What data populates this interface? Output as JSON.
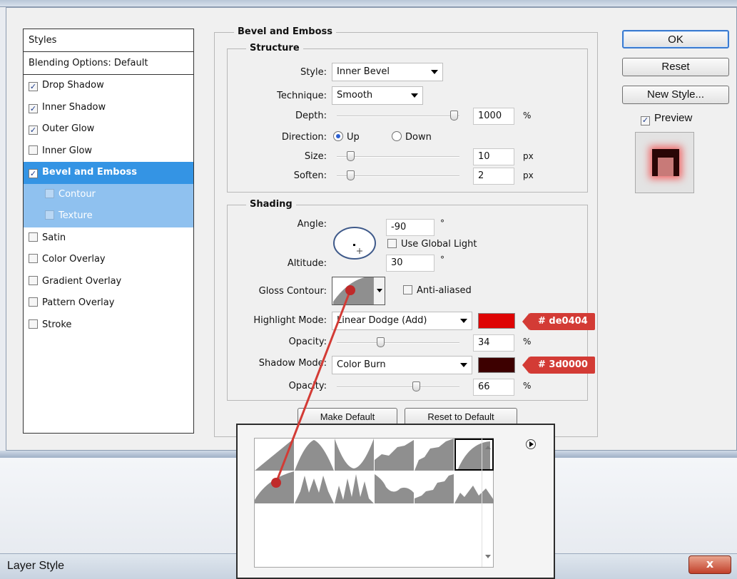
{
  "window": {
    "title": "Layer Style",
    "close_label": "x"
  },
  "styles_panel": {
    "header": "Styles",
    "blending": "Blending Options: Default",
    "items": [
      {
        "label": "Drop Shadow",
        "checked": true
      },
      {
        "label": "Inner Shadow",
        "checked": true
      },
      {
        "label": "Outer Glow",
        "checked": true
      },
      {
        "label": "Inner Glow",
        "checked": false
      },
      {
        "label": "Bevel and Emboss",
        "checked": true,
        "selected": true
      },
      {
        "label": "Contour",
        "checked": false,
        "sub": true
      },
      {
        "label": "Texture",
        "checked": false,
        "sub": true
      },
      {
        "label": "Satin",
        "checked": false
      },
      {
        "label": "Color Overlay",
        "checked": false
      },
      {
        "label": "Gradient Overlay",
        "checked": false
      },
      {
        "label": "Pattern Overlay",
        "checked": false
      },
      {
        "label": "Stroke",
        "checked": false
      }
    ]
  },
  "bevel": {
    "title": "Bevel and Emboss",
    "structure": {
      "title": "Structure",
      "style_label": "Style:",
      "style_value": "Inner Bevel",
      "technique_label": "Technique:",
      "technique_value": "Smooth",
      "depth_label": "Depth:",
      "depth_value": "1000",
      "depth_unit": "%",
      "depth_level": 1.0,
      "direction_label": "Direction:",
      "up_label": "Up",
      "down_label": "Down",
      "direction_value": "Up",
      "size_label": "Size:",
      "size_value": "10",
      "size_unit": "px",
      "size_level": 0.07,
      "soften_label": "Soften:",
      "soften_value": "2",
      "soften_unit": "px",
      "soften_level": 0.07
    },
    "shading": {
      "title": "Shading",
      "angle_label": "Angle:",
      "angle_value": "-90",
      "angle_unit": "°",
      "global_light_label": "Use Global Light",
      "global_light": false,
      "altitude_label": "Altitude:",
      "altitude_value": "30",
      "altitude_unit": "°",
      "gloss_label": "Gloss Contour:",
      "anti_aliased_label": "Anti-aliased",
      "anti_aliased": false,
      "highlight_label": "Highlight Mode:",
      "highlight_mode": "Linear Dodge (Add)",
      "highlight_color": "#de0404",
      "highlight_tag": "# de0404",
      "opacity1_label": "Opacity:",
      "opacity1_value": "34",
      "opacity1_unit": "%",
      "opacity1_level": 0.34,
      "shadow_label": "Shadow Mode:",
      "shadow_mode": "Color Burn",
      "shadow_color": "#3d0000",
      "shadow_tag": "# 3d0000",
      "opacity2_label": "Opacity:",
      "opacity2_value": "66",
      "opacity2_unit": "%",
      "opacity2_level": 0.66
    },
    "make_default": "Make Default",
    "reset_default": "Reset to Default"
  },
  "buttons": {
    "ok": "OK",
    "reset": "Reset",
    "new_style": "New Style...",
    "preview_label": "Preview",
    "preview": true
  },
  "colors": {
    "accent": "#3494e4",
    "annotation": "#d33b35",
    "contour_fill": "#8f8f8f"
  }
}
